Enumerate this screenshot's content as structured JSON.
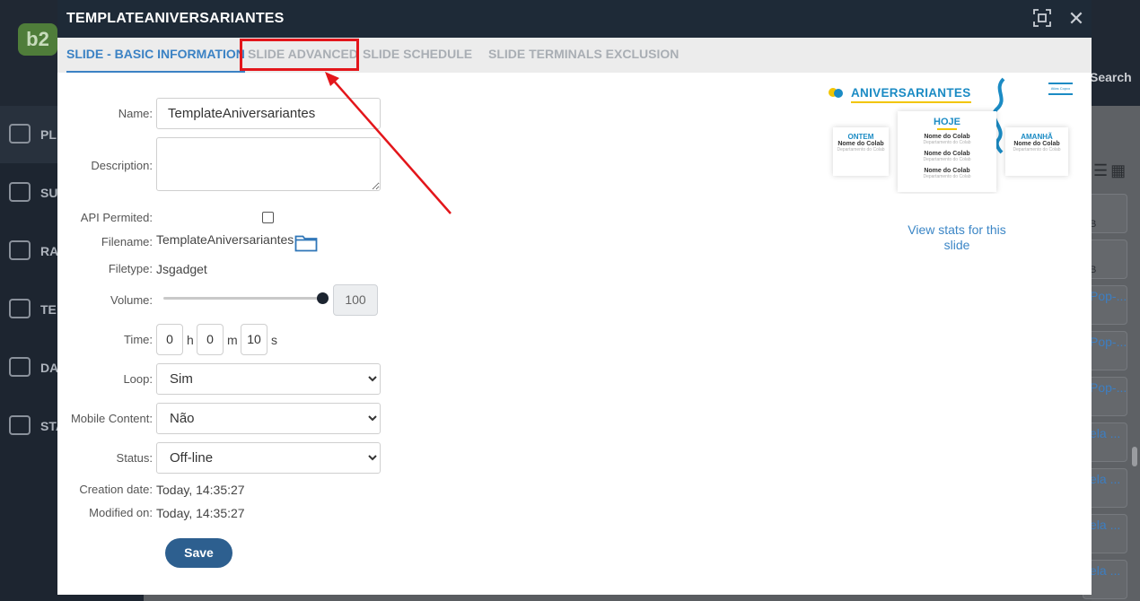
{
  "background": {
    "logo": "b2",
    "search_label": "Search",
    "sidebar_items": [
      "PL",
      "SU",
      "RA",
      "TE",
      "DAT",
      "STA"
    ],
    "row_texts": [
      "Pop-...",
      "Pop-...",
      "Pop-...",
      "ela ...",
      "ela ...",
      "ela ...",
      "ela ..."
    ],
    "row_letters": [
      "B",
      "B"
    ]
  },
  "modal": {
    "title": "TEMPLATEANIVERSARIANTES",
    "tabs": [
      {
        "label": "SLIDE - BASIC INFORMATION"
      },
      {
        "label": "SLIDE ADVANCED"
      },
      {
        "label": "SLIDE SCHEDULE"
      },
      {
        "label": "SLIDE TERMINALS EXCLUSION"
      }
    ]
  },
  "form": {
    "name_label": "Name:",
    "name_value": "TemplateAniversariantes",
    "description_label": "Description:",
    "description_value": "",
    "api_label": "API Permited:",
    "api_checked": false,
    "filename_label": "Filename:",
    "filename_value": "TemplateAniversariantes",
    "filetype_label": "Filetype:",
    "filetype_value": "Jsgadget",
    "volume_label": "Volume:",
    "volume_value": "100",
    "time_label": "Time:",
    "time_h": "0",
    "time_h_unit": "h",
    "time_m": "0",
    "time_m_unit": "m",
    "time_s": "10",
    "time_s_unit": "s",
    "loop_label": "Loop:",
    "loop_value": "Sim",
    "mobile_label": "Mobile Content:",
    "mobile_value": "Não",
    "status_label": "Status:",
    "status_value": "Off-line",
    "creation_label": "Creation date:",
    "creation_value": "Today, 14:35:27",
    "modified_label": "Modified on:",
    "modified_value": "Today, 14:35:27",
    "save_label": "Save"
  },
  "preview": {
    "title": "ANIVERSARIANTES",
    "brand": "Atlas Copco",
    "yesterday": "ONTEM",
    "today": "HOJE",
    "tomorrow": "AMANHÃ",
    "colab_name": "Nome do Colab",
    "colab_dept": "Departamento do Colab"
  },
  "stats_link": "View stats for this slide",
  "colors": {
    "header_bg": "#1e2a37",
    "tab_active": "#3b82c4",
    "highlight": "#e3161b",
    "save_bg": "#2d5f8f",
    "link": "#3b86c6"
  }
}
